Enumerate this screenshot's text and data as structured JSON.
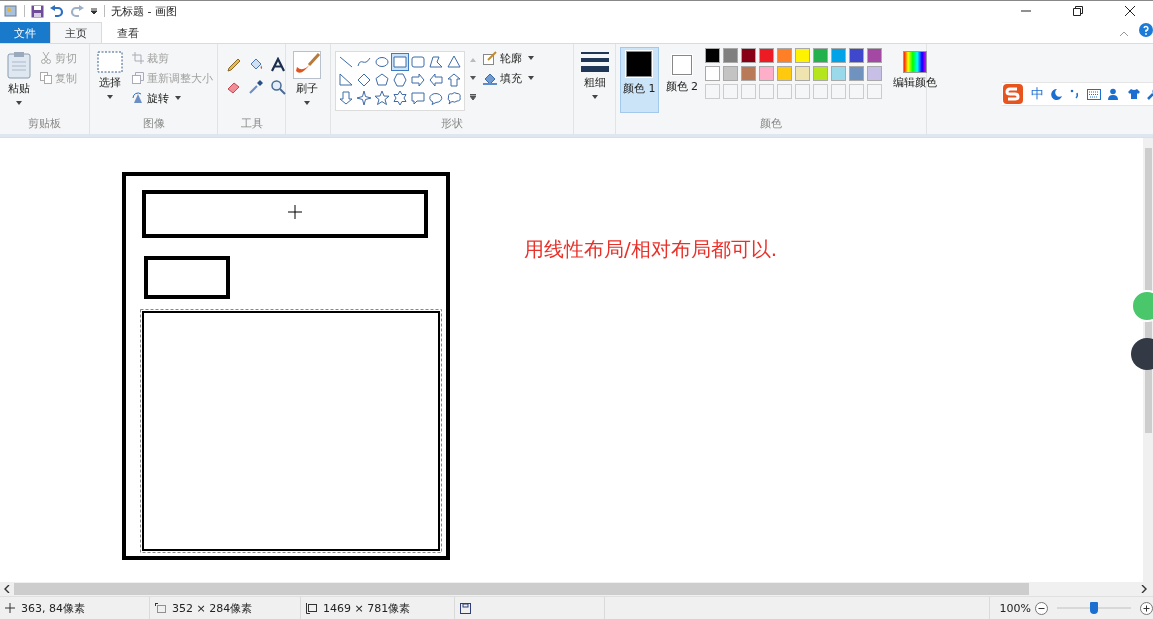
{
  "window": {
    "title": "无标题 - 画图"
  },
  "tabs": [
    {
      "label": "文件",
      "kind": "file",
      "selected": false
    },
    {
      "label": "主页",
      "kind": "tab",
      "selected": true
    },
    {
      "label": "查看",
      "kind": "tab",
      "selected": false
    }
  ],
  "clipboard": {
    "paste": "粘贴",
    "cut": "剪切",
    "copy": "复制",
    "label": "剪贴板"
  },
  "image": {
    "select": "选择",
    "crop": "裁剪",
    "resize": "重新调整大小",
    "rotate": "旋转",
    "label": "图像"
  },
  "tools": {
    "label": "工具"
  },
  "brushes": {
    "button": "刷子"
  },
  "shapes": {
    "items": [
      {
        "kind": "line",
        "selected": false
      },
      {
        "kind": "curve",
        "selected": false
      },
      {
        "kind": "oval",
        "selected": false
      },
      {
        "kind": "rectangle",
        "selected": true
      },
      {
        "kind": "rounded-rectangle",
        "selected": false
      },
      {
        "kind": "polygon",
        "selected": false
      },
      {
        "kind": "triangle",
        "selected": false
      },
      {
        "kind": "right-triangle",
        "selected": false
      },
      {
        "kind": "diamond",
        "selected": false
      },
      {
        "kind": "pentagon",
        "selected": false
      },
      {
        "kind": "hexagon",
        "selected": false
      },
      {
        "kind": "arrow-right",
        "selected": false
      },
      {
        "kind": "arrow-left",
        "selected": false
      },
      {
        "kind": "arrow-up",
        "selected": false
      },
      {
        "kind": "arrow-down",
        "selected": false
      },
      {
        "kind": "star4",
        "selected": false
      },
      {
        "kind": "star5",
        "selected": false
      },
      {
        "kind": "star6",
        "selected": false
      },
      {
        "kind": "callout-rect",
        "selected": false
      },
      {
        "kind": "callout-oval",
        "selected": false
      },
      {
        "kind": "callout-cloud",
        "selected": false
      }
    ],
    "outline": "轮廓",
    "fill": "填充",
    "label": "形状"
  },
  "size": {
    "label": "粗细"
  },
  "colors": {
    "current": [
      {
        "label": "颜色 1",
        "color": "#000000",
        "selected": true
      },
      {
        "label": "颜色 2",
        "color": "#ffffff",
        "selected": false
      }
    ],
    "swatches": [
      {
        "color": "#000000"
      },
      {
        "color": "#7f7f7f"
      },
      {
        "color": "#880015"
      },
      {
        "color": "#ed1c24"
      },
      {
        "color": "#ff7f27"
      },
      {
        "color": "#fff200"
      },
      {
        "color": "#22b14c"
      },
      {
        "color": "#00a2e8"
      },
      {
        "color": "#3f48cc"
      },
      {
        "color": "#a349a4"
      },
      {
        "color": "#ffffff"
      },
      {
        "color": "#c3c3c3"
      },
      {
        "color": "#b97a57"
      },
      {
        "color": "#ffaec9"
      },
      {
        "color": "#ffc90e"
      },
      {
        "color": "#efe4b0"
      },
      {
        "color": "#b5e61d"
      },
      {
        "color": "#99d9ea"
      },
      {
        "color": "#7092be"
      },
      {
        "color": "#c8bfe7"
      }
    ],
    "edit": "编辑颜色",
    "label": "颜色"
  },
  "ime": {
    "mode": "中"
  },
  "canvas": {
    "note": "用线性布局/相对布局都可以."
  },
  "status_bar": {
    "cursor": "363, 84像素",
    "selection": "352 × 284像素",
    "image_size": "1469 × 781像素",
    "zoom": "100%",
    "zoom_slider": {
      "level": 0.5
    }
  }
}
